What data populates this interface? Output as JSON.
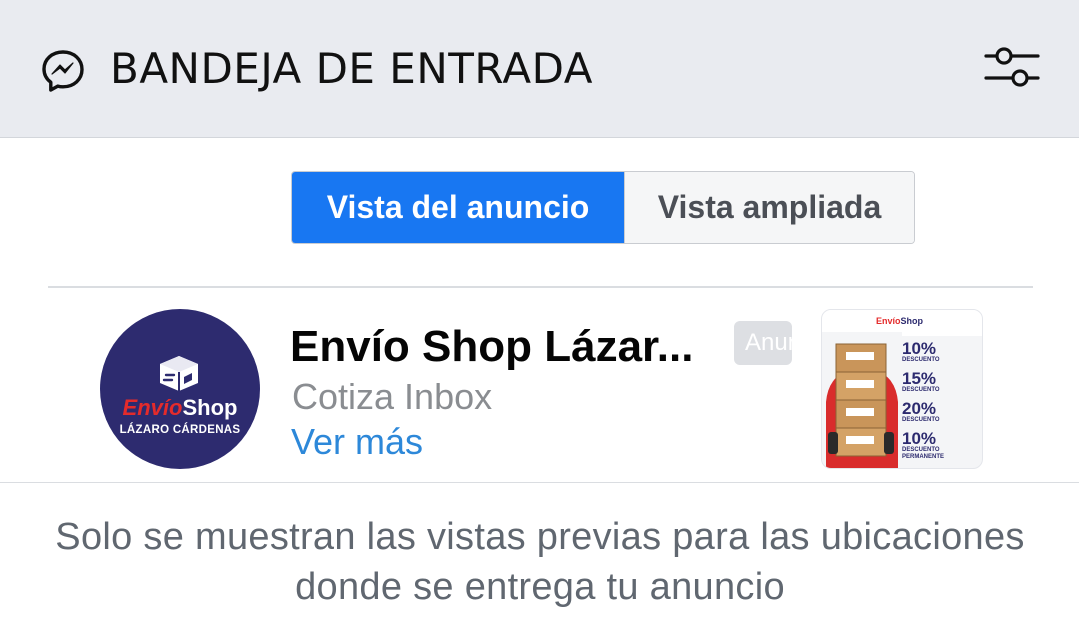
{
  "header": {
    "title": "BANDEJA DE ENTRADA",
    "messenger_icon": "messenger-icon",
    "filter_icon": "sliders-icon"
  },
  "tabs": [
    {
      "label": "Vista del anuncio",
      "active": true
    },
    {
      "label": "Vista ampliada",
      "active": false
    }
  ],
  "ad": {
    "title": "Envío Shop Lázar...",
    "subtitle": "Cotiza Inbox",
    "more_link": "Ver más",
    "badge": "Anuncio",
    "avatar": {
      "brand_part1": "Envío",
      "brand_part2": "Shop",
      "location": "LÁZARO CÁRDENAS"
    },
    "thumbnail": {
      "logo_part1": "Envío",
      "logo_part2": "Shop",
      "deals": [
        {
          "percent": "10%",
          "label": "DESCUENTO"
        },
        {
          "percent": "15%",
          "label": "DESCUENTO"
        },
        {
          "percent": "20%",
          "label": "DESCUENTO"
        },
        {
          "percent": "10%",
          "label": "DESCUENTO PERMANENTE"
        }
      ]
    }
  },
  "footer_note": "Solo se muestran las vistas previas para las ubicaciones donde se entrega tu anuncio",
  "colors": {
    "accent": "#1877f2",
    "link": "#2d88d9",
    "brand_navy": "#2d2b6f",
    "brand_red": "#e42b2b"
  }
}
